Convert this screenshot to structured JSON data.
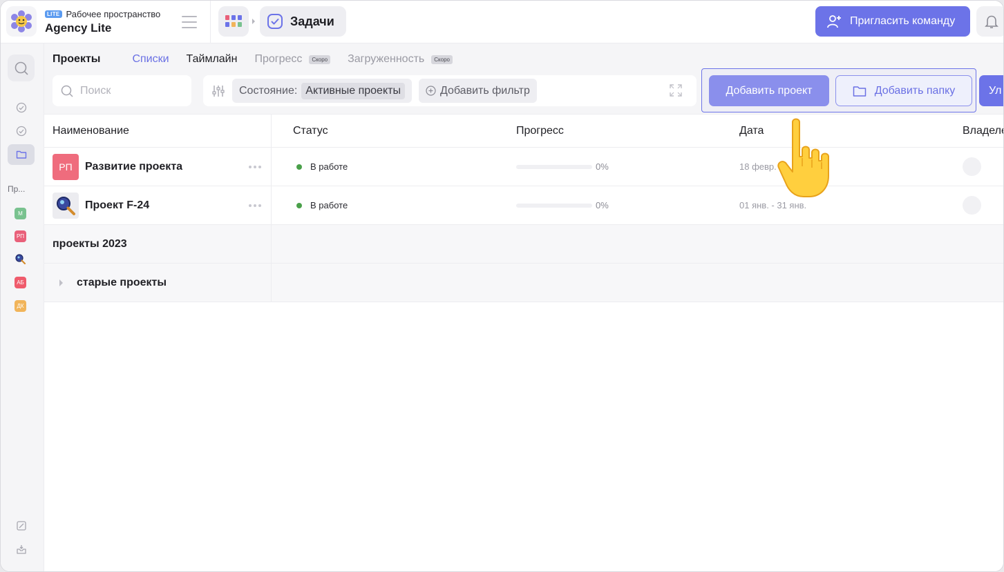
{
  "workspace": {
    "badge": "LITE",
    "label": "Рабочее пространство",
    "name": "Agency Lite"
  },
  "breadcrumb": {
    "current": "Задачи"
  },
  "header": {
    "invite_label": "Пригласить команду"
  },
  "sidebar": {
    "section_label": "Пр...",
    "projects": [
      {
        "initials": "М",
        "color": "#79c28f"
      },
      {
        "initials": "РП",
        "color": "#e9607a"
      },
      {
        "initials": "",
        "color": "#3a4aa0"
      },
      {
        "initials": "АБ",
        "color": "#ef5b6c"
      },
      {
        "initials": "ДК",
        "color": "#f1b45a"
      }
    ]
  },
  "tabs": [
    {
      "label": "Проекты"
    },
    {
      "label": "Списки"
    },
    {
      "label": "Таймлайн"
    },
    {
      "label": "Прогресс",
      "badge": "Скоро"
    },
    {
      "label": "Загруженность",
      "badge": "Скоро"
    }
  ],
  "search": {
    "placeholder": "Поиск",
    "value": ""
  },
  "filter": {
    "state_label": "Состояние:",
    "state_value": "Активные проекты",
    "add_filter_label": "Добавить фильтр"
  },
  "actions": {
    "add_project": "Добавить проект",
    "add_folder": "Добавить папку",
    "extra": "Ул"
  },
  "table": {
    "columns": [
      "Наименование",
      "Статус",
      "Прогресс",
      "Дата",
      "Владелец"
    ],
    "rows": [
      {
        "avatar": "РП",
        "avatar_color": "#ef6c7d",
        "name": "Развитие проекта",
        "status": "В работе",
        "progress": 0,
        "progress_text": "0%",
        "date": "18 февр. -"
      },
      {
        "avatar": "",
        "avatar_color": "#ececf0",
        "name": "Проект F-24",
        "status": "В работе",
        "progress": 0,
        "progress_text": "0%",
        "date": "01 янв. - 31 янв."
      }
    ],
    "groups": [
      {
        "name": "проекты 2023",
        "expandable": false
      },
      {
        "name": "старые проекты",
        "expandable": true
      }
    ]
  },
  "colors": {
    "accent": "#6c73e8",
    "status_in_progress": "#4aa04a"
  },
  "icons": [
    "logo-icon",
    "hamburger-icon",
    "apps-grid-icon",
    "check-square-icon",
    "add-user-icon",
    "bell-icon",
    "search-icon",
    "check-circle-icon",
    "folder-icon",
    "filter-sliders-icon",
    "plus-circle-icon",
    "expand-icon",
    "pointing-hand-icon"
  ]
}
